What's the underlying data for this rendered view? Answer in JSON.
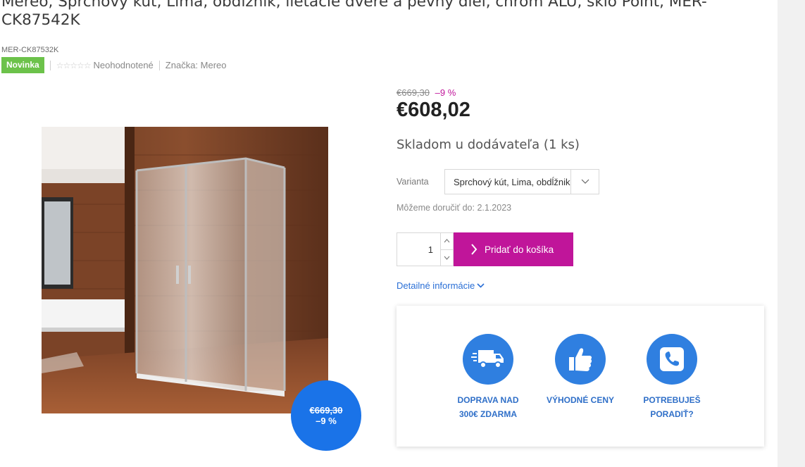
{
  "product": {
    "title": "Mereo, Sprchový kút, Lima, obdĺžnik, lietacie dvere a pevný diel, chróm ALU, sklo Point, MER-CK87542K",
    "sku": "MER-CK87532K",
    "badge": "Novinka",
    "rating_stars": "☆☆☆☆☆",
    "rating_text": "Neohodnotené",
    "brand_text": "Značka: Mereo"
  },
  "pricing": {
    "old_price": "€669,30",
    "discount": "–9 %",
    "price": "€608,02",
    "flag_old_price": "€669,30",
    "flag_discount": "–9 %"
  },
  "availability": "Skladom u dodávateľa (1 ks)",
  "variant": {
    "label": "Varianta",
    "selected": "Sprchový kút, Lima, obdĺžnik"
  },
  "delivery": "Môžeme doručiť do: 2.1.2023",
  "cart": {
    "quantity": "1",
    "button_label": "Pridať do košíka"
  },
  "details_link": "Detailné informácie",
  "benefits": [
    {
      "icon": "truck-icon",
      "line1": "DOPRAVA NAD",
      "line2": "300€ ZDARMA"
    },
    {
      "icon": "thumbs-up-icon",
      "line1": "VÝHODNÉ CENY",
      "line2": ""
    },
    {
      "icon": "phone-icon",
      "line1": "POTREBUJEŠ",
      "line2": "PORADIŤ?"
    }
  ],
  "colors": {
    "accent": "#c0159a",
    "blue": "#2f7fe0",
    "badge_green": "#6cc24a"
  }
}
